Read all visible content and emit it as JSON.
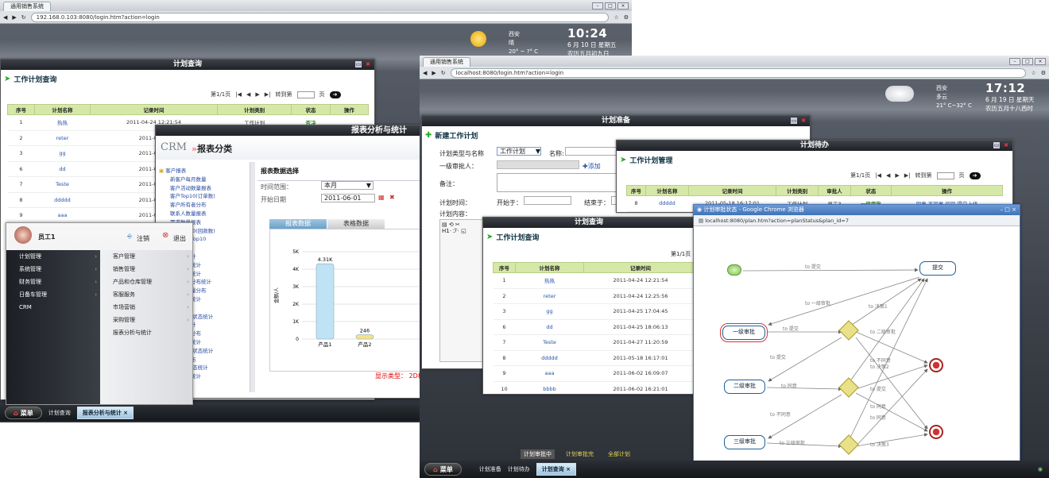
{
  "left": {
    "browser_tab": "通用销售系统",
    "url": "192.168.0.103:8080/login.htm?action=login",
    "weather": {
      "city": "西安",
      "cond": "晴",
      "temp": "20° ~ ?° C"
    },
    "clock": {
      "time": "10:24",
      "date": "6 月 10 日 星期五",
      "lunar": "农历五月初九日"
    },
    "query_window": {
      "title": "计划查询",
      "heading": "工作计划查询",
      "pager": {
        "page": "第1/1页",
        "goto": "转到第",
        "unit": "页"
      },
      "columns": [
        "序号",
        "计划名称",
        "记录时间",
        "计划类别",
        "状态",
        "操作"
      ],
      "rows": [
        {
          "no": "1",
          "name": "热热",
          "time": "2011-04-24 12:21:54",
          "type": "工作计划",
          "status": "否决"
        },
        {
          "no": "2",
          "name": "reter",
          "time": "2011-04-24",
          "type": "",
          "status": ""
        },
        {
          "no": "3",
          "name": "gg",
          "time": "2011-04-25",
          "type": "",
          "status": ""
        },
        {
          "no": "6",
          "name": "dd",
          "time": "2011-04-25",
          "type": "",
          "status": ""
        },
        {
          "no": "7",
          "name": "Teste",
          "time": "2011-04-27",
          "type": "",
          "status": ""
        },
        {
          "no": "8",
          "name": "ddddd",
          "time": "2011-05-18",
          "type": "",
          "status": ""
        },
        {
          "no": "9",
          "name": "aaa",
          "time": "2011-06-02",
          "type": "",
          "status": ""
        }
      ]
    },
    "report_window": {
      "title": "报表分析与统计",
      "logo": "CRM",
      "heading": "报表分类",
      "tree_root": "客户报表",
      "tree_items": [
        "新客户每月数量",
        "客户活动数量报表",
        "客户Top10(订单数)",
        "客户所有者分布",
        "联系人数量报表",
        "需求数量报表",
        "需求Top10(回款数)",
        "客户活动Top10",
        "统计报表",
        "负责人统计",
        "状态数量统计",
        "活动类型统计",
        "活动阶段分布统计",
        "报价单数量分布",
        "活动状态统计",
        "统计",
        "类别/合同状态统计",
        "状态数统计",
        "订单数量分布",
        "订单数量统计",
        "人/报价单状态统计",
        "机会数分布",
        "人/订单状态统计",
        "来源数量统计",
        "报表"
      ],
      "panel_title": "报表数据选择",
      "filter_period_label": "时间范围：",
      "filter_period_value": "本月",
      "filter_start_label": "开始日期",
      "filter_start_value": "2011-06-01",
      "tab_chart": "报表数据",
      "tab_table": "表格数据",
      "footer": "显示类型： 2D柱",
      "chart_data": {
        "type": "bar",
        "categories": [
          "产品1",
          "产品2"
        ],
        "values": [
          4.31,
          0.246
        ],
        "labels": [
          "4.31K",
          "246"
        ],
        "ylabel": "金额/人",
        "yticks": [
          "0",
          "1K",
          "2K",
          "3K",
          "4K",
          "5K"
        ],
        "ylim": [
          0,
          5
        ]
      }
    },
    "start_menu": {
      "user": "员工1",
      "logout": "注销",
      "exit": "退出",
      "left_items": [
        "计划管理",
        "系统管理",
        "财务管理",
        "日备车管理",
        "CRM"
      ],
      "right_items": [
        "客户管理",
        "销售管理",
        "产品和仓库管理",
        "客服服务",
        "市场营销",
        "采购管理",
        "报表分析与统计"
      ]
    },
    "taskbar": {
      "start": "菜单",
      "items": [
        "计划查询",
        "报表分析与统计"
      ]
    }
  },
  "right": {
    "browser_tab": "通用销售系统",
    "url": "localhost:8080/login.htm?action=login",
    "weather": {
      "city": "西安",
      "cond": "多云",
      "temp": "21° C~32° C"
    },
    "clock": {
      "time": "17:12",
      "date": "6 月 19 日 星期天",
      "lunar": "农历五月十八西时"
    },
    "prep_window": {
      "title": "计划准备",
      "heading": "新建工作计划",
      "type_label": "计划类型与名称",
      "type_value": "工作计划",
      "name_label": "名称:",
      "approver_label": "一级审批人：",
      "add": "添加",
      "remark_label": "备注：",
      "interval_label": "计划时间：",
      "start_label": "开始于：",
      "end_label": "结束于：",
      "content_label": "计划内容："
    },
    "pending_window": {
      "title": "计划待办",
      "heading": "工作计划管理",
      "pager": {
        "page": "第1/1页",
        "goto": "转到第",
        "unit": "页"
      },
      "columns": [
        "序号",
        "计划名称",
        "记录时间",
        "计划类别",
        "审批人",
        "状态",
        "操作"
      ],
      "row": {
        "no": "8",
        "name": "ddddd",
        "time": "2011-05-18 16:17:01",
        "type": "工作计划",
        "approver": "员工3",
        "status": "一级审批",
        "ops": "同意 不同意 驳回 提交上级"
      }
    },
    "query_window": {
      "title": "计划查询",
      "heading": "工作计划查询",
      "pager": "第1/1页",
      "columns": [
        "序号",
        "计划名称",
        "记录时间"
      ],
      "rows": [
        {
          "no": "1",
          "name": "热热",
          "time": "2011-04-24 12:21:54"
        },
        {
          "no": "2",
          "name": "reter",
          "time": "2011-04-24 12:25:56"
        },
        {
          "no": "3",
          "name": "gg",
          "time": "2011-04-25 17:04:45"
        },
        {
          "no": "6",
          "name": "dd",
          "time": "2011-04-25 18:06:13"
        },
        {
          "no": "7",
          "name": "Teste",
          "time": "2011-04-27 11:20:59"
        },
        {
          "no": "8",
          "name": "ddddd",
          "time": "2011-05-18 16:17:01"
        },
        {
          "no": "9",
          "name": "aaa",
          "time": "2011-06-02 16:09:07"
        },
        {
          "no": "10",
          "name": "bbbb",
          "time": "2011-06-02 16:21:01"
        }
      ]
    },
    "popup": {
      "title": "计划审批状态 - Google Chrome 浏览器",
      "url": "localhost:8080/plan.htm?action=planStatus&plan_id=7",
      "nodes": {
        "submit": "提交",
        "first": "一级审批",
        "second": "二级审批",
        "third": "三级审批"
      },
      "edges": [
        "to 提交",
        "to 一级审批",
        "to 提交",
        "to 决策1",
        "to 提交",
        "to 二级审批",
        "to 同意",
        "to 决策2",
        "to 提交",
        "to 不同意",
        "to 三级审批",
        "to 同意",
        "to 决策3",
        "to 不同意",
        "to 同意"
      ]
    },
    "status_tabs": [
      "计划审批中",
      "计划审批完",
      "全部计划"
    ],
    "taskbar": {
      "start": "菜单",
      "items": [
        "计划准备",
        "计划待办",
        "计划查询"
      ]
    }
  }
}
